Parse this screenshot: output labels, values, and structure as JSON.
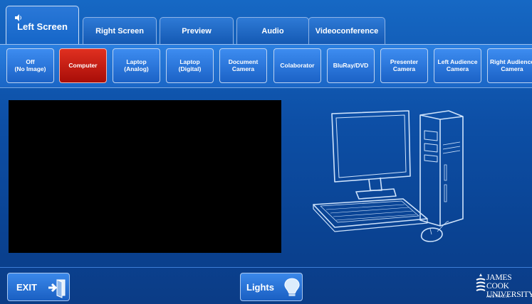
{
  "tabs": [
    {
      "label": "Left Screen",
      "active": true
    },
    {
      "label": "Right Screen",
      "active": false
    },
    {
      "label": "Preview",
      "active": false
    },
    {
      "label": "Audio",
      "active": false
    },
    {
      "label": "Videoconference",
      "active": false
    }
  ],
  "sources": [
    {
      "label": "Off\n(No Image)",
      "selected": false
    },
    {
      "label": "Computer",
      "selected": true
    },
    {
      "label": "Laptop\n(Analog)",
      "selected": false
    },
    {
      "label": "Laptop\n(Digital)",
      "selected": false
    },
    {
      "label": "Document\nCamera",
      "selected": false
    },
    {
      "label": "Colaborator",
      "selected": false
    },
    {
      "label": "BluRay/DVD",
      "selected": false
    },
    {
      "label": "Presenter\nCamera",
      "selected": false
    },
    {
      "label": "Left Audience\nCamera",
      "selected": false
    },
    {
      "label": "Right Audience\nCamera",
      "selected": false
    }
  ],
  "exit_label": "EXIT",
  "lights_label": "Lights",
  "logo": {
    "line1": "JAMES COOK",
    "line2": "UNIVERSITY",
    "line3": "AUSTRALIA"
  },
  "colors": {
    "selected_source": "#c41a10",
    "background": "#0d4fa6"
  }
}
